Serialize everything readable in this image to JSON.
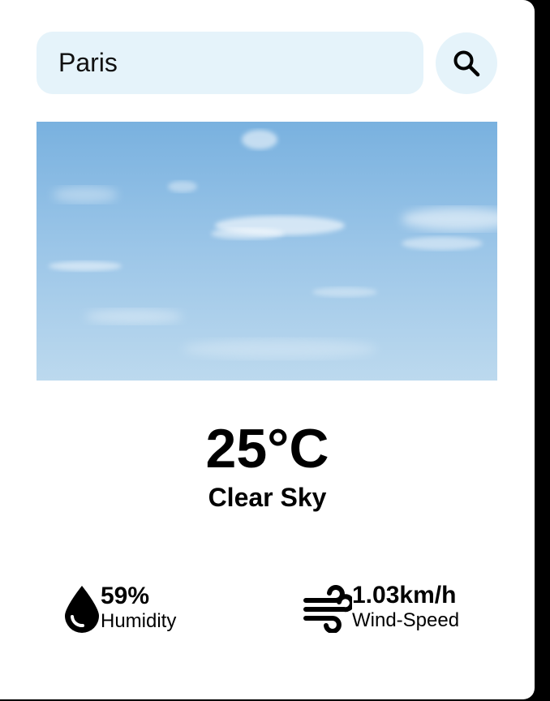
{
  "search": {
    "value": "Paris",
    "button_icon": "search-icon"
  },
  "weather": {
    "image": "clear-sky-image",
    "temperature": "25°C",
    "description": "Clear Sky"
  },
  "stats": {
    "humidity": {
      "icon": "water-drop-icon",
      "value": "59%",
      "label": "Humidity"
    },
    "wind": {
      "icon": "wind-icon",
      "value": "1.03km/h",
      "label": "Wind-Speed"
    }
  },
  "colors": {
    "search_bg": "#e5f3fa",
    "sky_top": "#79b1df",
    "sky_bottom": "#b9d8ee",
    "text": "#000000"
  }
}
